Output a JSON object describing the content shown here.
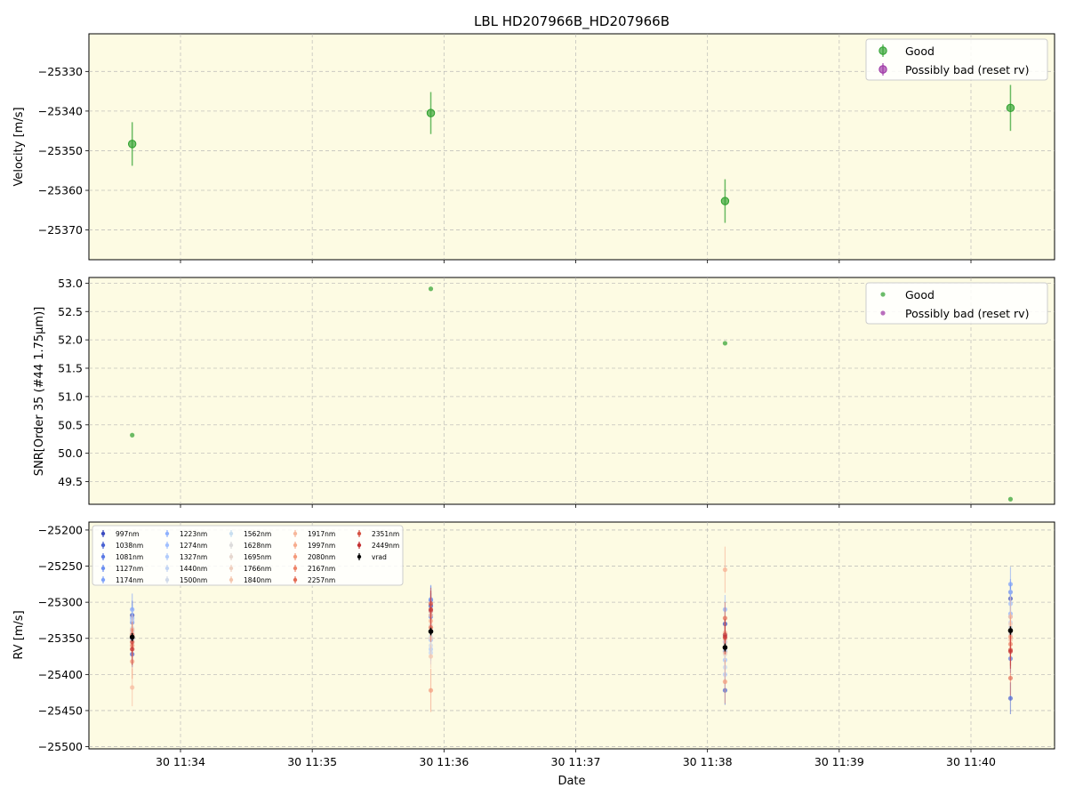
{
  "chart_data": [
    {
      "type": "scatter",
      "title": "LBL HD207966B_HD207966B",
      "ylabel": "Velocity [m/s]",
      "xlabel": "",
      "ylim": [
        -25377.5,
        -25320.5
      ],
      "yticks": [
        -25330,
        -25340,
        -25350,
        -25360,
        -25370
      ],
      "ytick_labels": [
        "−25330",
        "−25340",
        "−25350",
        "−25360",
        "−25370"
      ],
      "grid": true,
      "legend": "top-right",
      "series": [
        {
          "name": "Good",
          "color": "#2ca02c",
          "x": [
            "11:33:38",
            "11:35:54",
            "11:38:08",
            "11:40:18"
          ],
          "y": [
            -25348.3,
            -25340.5,
            -25362.7,
            -25339.2
          ],
          "err": [
            5.5,
            5.3,
            5.5,
            5.8
          ]
        },
        {
          "name": "Possibly bad (reset rv)",
          "color": "#9b30a3",
          "x": [],
          "y": [],
          "err": []
        }
      ]
    },
    {
      "type": "scatter",
      "title": "",
      "ylabel": "SNR[Order 35 (#44 1.75μm)]",
      "xlabel": "",
      "ylim": [
        49.1,
        53.1
      ],
      "yticks": [
        53.0,
        52.5,
        52.0,
        51.5,
        51.0,
        50.5,
        50.0,
        49.5
      ],
      "ytick_labels": [
        "53.0",
        "52.5",
        "52.0",
        "51.5",
        "51.0",
        "50.5",
        "50.0",
        "49.5"
      ],
      "grid": true,
      "legend": "top-right",
      "series": [
        {
          "name": "Good",
          "color": "#2ca02c",
          "x": [
            "11:33:38",
            "11:35:54",
            "11:38:08",
            "11:40:18"
          ],
          "y": [
            50.32,
            52.9,
            51.94,
            49.19
          ]
        },
        {
          "name": "Possibly bad (reset rv)",
          "color": "#9b30a3",
          "x": [],
          "y": []
        }
      ]
    },
    {
      "type": "scatter",
      "title": "",
      "ylabel": "RV [m/s]",
      "xlabel": "Date",
      "ylim": [
        -25503,
        -25189
      ],
      "yticks": [
        -25200,
        -25250,
        -25300,
        -25350,
        -25400,
        -25450,
        -25500
      ],
      "ytick_labels": [
        "−25200",
        "−25250",
        "−25300",
        "−25350",
        "−25400",
        "−25450",
        "−25500"
      ],
      "grid": true,
      "legend": "top-left",
      "x_times": [
        "11:33:38",
        "11:35:54",
        "11:38:08",
        "11:40:18"
      ],
      "xticks": [
        "11:34",
        "11:35",
        "11:36",
        "11:37",
        "11:38",
        "11:39",
        "11:40"
      ],
      "xtick_labels": [
        "30 11:34",
        "30 11:35",
        "30 11:36",
        "30 11:37",
        "30 11:38",
        "30 11:39",
        "30 11:40"
      ],
      "series": [
        {
          "name": "997nm",
          "color": "#3b4cc0",
          "y": [
            -25318,
            -25305,
            -25330,
            -25295
          ],
          "err": [
            20,
            18,
            22,
            20
          ]
        },
        {
          "name": "1038nm",
          "color": "#4a63d3",
          "y": [
            -25372,
            -25297,
            -25422,
            -25433
          ],
          "err": [
            18,
            20,
            20,
            22
          ]
        },
        {
          "name": "1081nm",
          "color": "#5b7ae5",
          "y": [
            -25350,
            -25320,
            -25345,
            -25378
          ],
          "err": [
            16,
            18,
            20,
            20
          ]
        },
        {
          "name": "1127nm",
          "color": "#6c8ff1",
          "y": [
            -25328,
            -25312,
            -25368,
            -25286
          ],
          "err": [
            14,
            16,
            18,
            18
          ]
        },
        {
          "name": "1174nm",
          "color": "#7ea1fa",
          "y": [
            -25310,
            -25296,
            -25355,
            -25275
          ],
          "err": [
            22,
            20,
            24,
            24
          ]
        },
        {
          "name": "1223nm",
          "color": "#8fb1fe",
          "y": [
            -25322,
            -25318,
            -25310,
            -25316
          ],
          "err": [
            18,
            18,
            20,
            20
          ]
        },
        {
          "name": "1274nm",
          "color": "#a1c0ff",
          "y": [
            -25340,
            -25352,
            -25380,
            -25302
          ],
          "err": [
            16,
            18,
            20,
            20
          ]
        },
        {
          "name": "1327nm",
          "color": "#b2ccfb",
          "y": [
            -25325,
            -25365,
            -25400,
            -25320
          ],
          "err": [
            14,
            16,
            18,
            16
          ]
        },
        {
          "name": "1440nm",
          "color": "#c3d5f4",
          "y": [
            -25345,
            -25370,
            -25390,
            -25328
          ],
          "err": [
            14,
            16,
            16,
            16
          ]
        },
        {
          "name": "1500nm",
          "color": "#d1dae9",
          "y": [
            -25352,
            -25360,
            -25365,
            -25335
          ],
          "err": [
            12,
            14,
            14,
            14
          ]
        },
        {
          "name": "1562nm",
          "color": "#c9dff0",
          "y": [
            -25336,
            -25348,
            -25350,
            -25342
          ],
          "err": [
            12,
            14,
            14,
            14
          ]
        },
        {
          "name": "1628nm",
          "color": "#dddcdc",
          "y": [
            -25348,
            -25340,
            -25372,
            -25345
          ],
          "err": [
            12,
            12,
            14,
            14
          ]
        },
        {
          "name": "1695nm",
          "color": "#e6d7cf",
          "y": [
            -25356,
            -25332,
            -25360,
            -25338
          ],
          "err": [
            12,
            12,
            14,
            14
          ]
        },
        {
          "name": "1766nm",
          "color": "#efcfbf",
          "y": [
            -25342,
            -25350,
            -25355,
            -25330
          ],
          "err": [
            12,
            14,
            14,
            14
          ]
        },
        {
          "name": "1840nm",
          "color": "#f4c5ad",
          "y": [
            -25365,
            -25375,
            -25370,
            -25352
          ],
          "err": [
            14,
            16,
            16,
            16
          ]
        },
        {
          "name": "1917nm",
          "color": "#f7b89c",
          "y": [
            -25418,
            -25318,
            -25342,
            -25320
          ],
          "err": [
            26,
            24,
            28,
            28
          ]
        },
        {
          "name": "1997nm",
          "color": "#f7ac8e",
          "y": [
            -25338,
            -25326,
            -25255,
            -25340
          ],
          "err": [
            20,
            22,
            32,
            26
          ]
        },
        {
          "name": "2080nm",
          "color": "#f49a7b",
          "y": [
            -25382,
            -25422,
            -25410,
            -25348
          ],
          "err": [
            24,
            30,
            30,
            28
          ]
        },
        {
          "name": "2167nm",
          "color": "#ee8468",
          "y": [
            -25360,
            -25312,
            -25350,
            -25358
          ],
          "err": [
            18,
            20,
            22,
            22
          ]
        },
        {
          "name": "2257nm",
          "color": "#e36c55",
          "y": [
            -25345,
            -25335,
            -25322,
            -25405
          ],
          "err": [
            18,
            20,
            22,
            24
          ]
        },
        {
          "name": "2351nm",
          "color": "#d65244",
          "y": [
            -25355,
            -25302,
            -25345,
            -25366
          ],
          "err": [
            18,
            22,
            22,
            22
          ]
        },
        {
          "name": "2449nm",
          "color": "#c43032",
          "y": [
            -25365,
            -25310,
            -25348,
            -25368
          ],
          "err": [
            22,
            26,
            24,
            24
          ]
        },
        {
          "name": "vrad",
          "color": "#000000",
          "y": [
            -25348.3,
            -25340.5,
            -25362.7,
            -25339.2
          ],
          "err": [
            5.5,
            5.3,
            5.5,
            5.8
          ]
        }
      ]
    }
  ]
}
